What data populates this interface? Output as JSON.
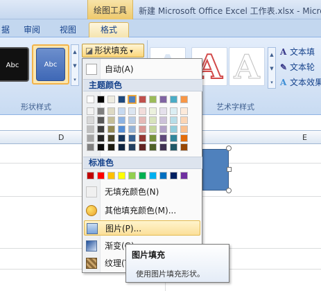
{
  "title_bar": {
    "contextual_tools_label": "绘图工具",
    "window_title": "新建 Microsoft Office Excel 工作表.xlsx - Micro"
  },
  "tabs": [
    {
      "label": "据"
    },
    {
      "label": "审阅"
    },
    {
      "label": "视图"
    },
    {
      "label": "格式",
      "active": true
    }
  ],
  "ribbon": {
    "shape_styles": {
      "group_label": "形状样式",
      "style_black_label": "Abc",
      "style_blue_label": "Abc"
    },
    "shape_fill_button": "形状填充",
    "wordart_styles": {
      "group_label": "艺术字样式",
      "sample_glyph": "A"
    },
    "text_options": [
      {
        "label": "文本填",
        "icon": "text-fill-icon"
      },
      {
        "label": "文本轮",
        "icon": "text-outline-icon"
      },
      {
        "label": "文本效果",
        "icon": "text-effects-icon"
      }
    ]
  },
  "columns": [
    {
      "label": "D"
    },
    {
      "label": "E"
    }
  ],
  "menu": {
    "auto_label": "自动(A)",
    "theme_colors_header": "主题颜色",
    "standard_colors_header": "标准色",
    "items": [
      {
        "label": "无填充颜色(N)",
        "icon": "no-fill-icon"
      },
      {
        "label": "其他填充颜色(M)...",
        "icon": "color-palette-icon"
      },
      {
        "label": "图片(P)...",
        "icon": "picture-icon",
        "highlighted": true
      },
      {
        "label": "渐变(G)",
        "icon": "gradient-icon"
      },
      {
        "label": "纹理(T)",
        "icon": "texture-icon"
      }
    ],
    "theme_colors_top": [
      "#ffffff",
      "#000000",
      "#eeece1",
      "#1f497d",
      "#4f81bd",
      "#c0504d",
      "#9bbb59",
      "#8064a2",
      "#4bacc6",
      "#f79646"
    ],
    "theme_colors_shades": [
      [
        "#f2f2f2",
        "#7f7f7f",
        "#ddd9c3",
        "#c6d9f0",
        "#dbe5f1",
        "#f2dcdb",
        "#ebf1dd",
        "#e5e0ec",
        "#dbeef3",
        "#fdeada"
      ],
      [
        "#d8d8d8",
        "#595959",
        "#c4bd97",
        "#8db3e2",
        "#b8cce4",
        "#e5b9b7",
        "#d7e3bc",
        "#ccc1d9",
        "#b7dde8",
        "#fbd5b5"
      ],
      [
        "#bfbfbf",
        "#3f3f3f",
        "#938953",
        "#548dd4",
        "#95b3d7",
        "#d99694",
        "#c3d69b",
        "#b2a2c7",
        "#92cddc",
        "#fac08f"
      ],
      [
        "#a5a5a5",
        "#262626",
        "#494429",
        "#17365d",
        "#366092",
        "#953734",
        "#76923c",
        "#5f497a",
        "#31859b",
        "#e36c09"
      ],
      [
        "#7f7f7f",
        "#0c0c0c",
        "#1d1b10",
        "#0f243e",
        "#244061",
        "#632423",
        "#4f6128",
        "#3f3151",
        "#205867",
        "#974806"
      ]
    ],
    "standard_colors": [
      "#c00000",
      "#ff0000",
      "#ffc000",
      "#ffff00",
      "#92d050",
      "#00b050",
      "#00b0f0",
      "#0070c0",
      "#002060",
      "#7030a0"
    ],
    "selected_theme_index": 4
  },
  "tooltip": {
    "title": "图片填充",
    "description": "使用图片填充形状。"
  }
}
